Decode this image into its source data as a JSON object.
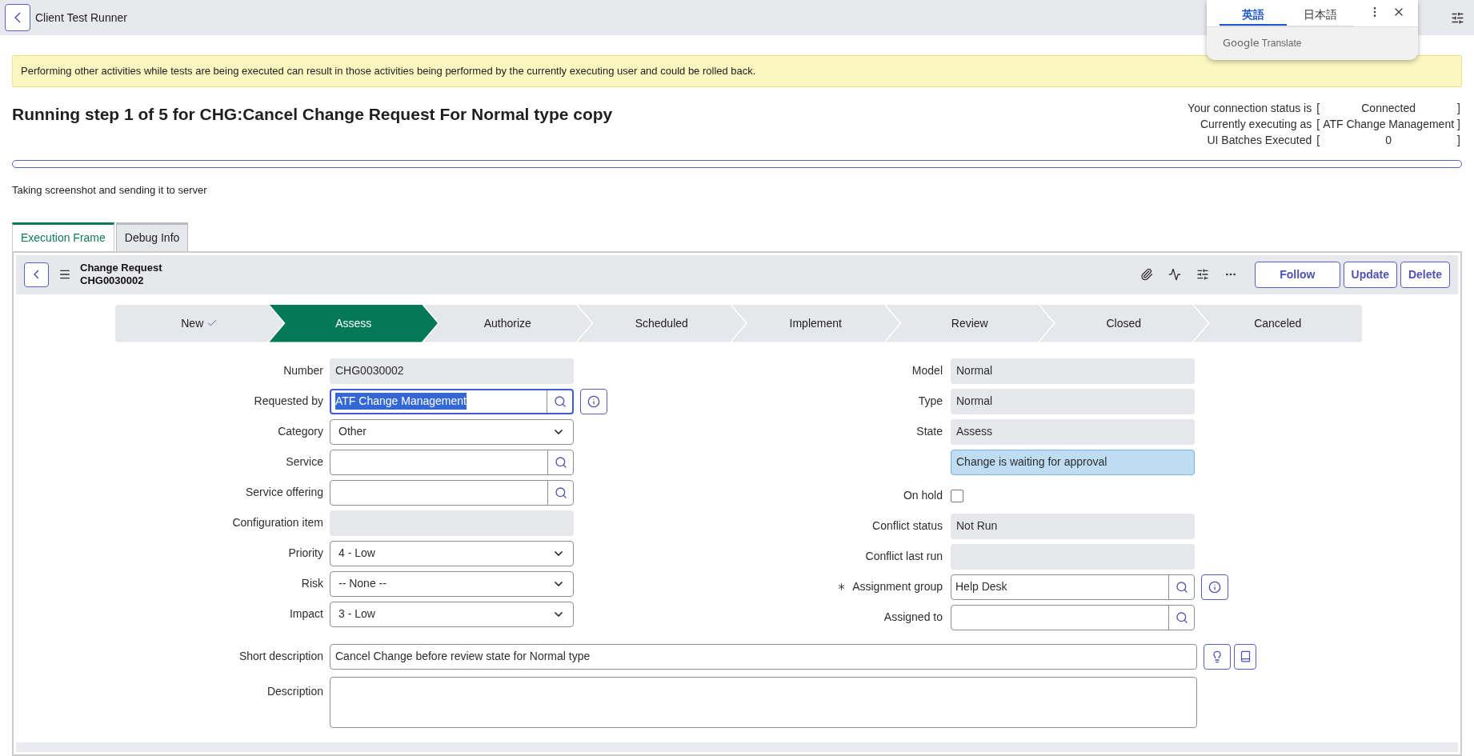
{
  "top_bar": {
    "title": "Client Test Runner"
  },
  "translate_popup": {
    "tabs": [
      {
        "label": "英語",
        "selected": true
      },
      {
        "label": "日本語",
        "selected": false
      }
    ],
    "brand": "Google",
    "caption": "Translate"
  },
  "banner": "Performing other activities while tests are being executed can result in those activities being performed by the currently executing user and could be rolled back.",
  "heading": "Running step 1 of 5 for CHG:Cancel Change Request For Normal type copy",
  "connection": [
    {
      "label": "Your connection status is",
      "open": "[",
      "value": "Connected",
      "close": "]"
    },
    {
      "label": "Currently executing as",
      "open": "[",
      "value": "ATF Change Management",
      "close": "]"
    },
    {
      "label": "UI Batches Executed",
      "open": "[",
      "value": "0",
      "close": "]"
    }
  ],
  "progress": {
    "level": 0
  },
  "status_message": "Taking screenshot and sending it to server",
  "tabs": [
    {
      "label": "Execution Frame",
      "selected": true
    },
    {
      "label": "Debug Info",
      "selected": false
    }
  ],
  "record": {
    "table": "Change Request",
    "number": "CHG0030002",
    "buttons": [
      "Follow",
      "Update",
      "Delete"
    ]
  },
  "stages": [
    {
      "label": "New",
      "completed": true,
      "selected": false
    },
    {
      "label": "Assess",
      "completed": false,
      "selected": true
    },
    {
      "label": "Authorize",
      "completed": false,
      "selected": false
    },
    {
      "label": "Scheduled",
      "completed": false,
      "selected": false
    },
    {
      "label": "Implement",
      "completed": false,
      "selected": false
    },
    {
      "label": "Review",
      "completed": false,
      "selected": false
    },
    {
      "label": "Closed",
      "completed": false,
      "selected": false
    },
    {
      "label": "Canceled",
      "completed": false,
      "selected": false
    }
  ],
  "left_fields": [
    {
      "label": "Number",
      "kind": "readonly",
      "value": "CHG0030002",
      "mandatory": false
    },
    {
      "label": "Requested by",
      "kind": "reference",
      "value": "ATF Change Management",
      "mandatory": false,
      "text_selected": true,
      "info": true
    },
    {
      "label": "Category",
      "kind": "select",
      "value": "Other",
      "mandatory": false
    },
    {
      "label": "Service",
      "kind": "reference",
      "mandatory": false,
      "text_selected": false,
      "info": false
    },
    {
      "label": "Service offering",
      "kind": "reference",
      "mandatory": false,
      "text_selected": false,
      "info": false
    },
    {
      "label": "Configuration item",
      "kind": "readonly",
      "mandatory": false
    },
    {
      "label": "Priority",
      "kind": "select",
      "value": "4 - Low",
      "mandatory": false
    },
    {
      "label": "Risk",
      "kind": "select",
      "value": "-- None --",
      "mandatory": false
    },
    {
      "label": "Impact",
      "kind": "select",
      "value": "3 - Low",
      "mandatory": false
    }
  ],
  "right_fields": [
    {
      "label": "Model",
      "kind": "readonly",
      "value": "Normal",
      "mandatory": false
    },
    {
      "label": "Type",
      "kind": "readonly",
      "value": "Normal",
      "mandatory": false
    },
    {
      "label": "State",
      "kind": "readonly",
      "value": "Assess",
      "mandatory": false
    },
    {
      "kind": "message",
      "value": "Change is waiting for approval"
    },
    {
      "label": "On hold",
      "kind": "checkbox",
      "checked": false,
      "mandatory": false
    },
    {
      "label": "Conflict status",
      "kind": "readonly",
      "value": "Not Run",
      "mandatory": false
    },
    {
      "label": "Conflict last run",
      "kind": "readonly",
      "mandatory": false
    },
    {
      "label": "Assignment group",
      "kind": "reference",
      "value": "Help Desk",
      "mandatory": true,
      "text_selected": false,
      "info": true
    },
    {
      "label": "Assigned to",
      "kind": "reference",
      "mandatory": false,
      "text_selected": false,
      "info": false
    }
  ],
  "short_description": {
    "label": "Short description",
    "value": "Cancel Change before review state for Normal type"
  },
  "description": {
    "label": "Description"
  }
}
